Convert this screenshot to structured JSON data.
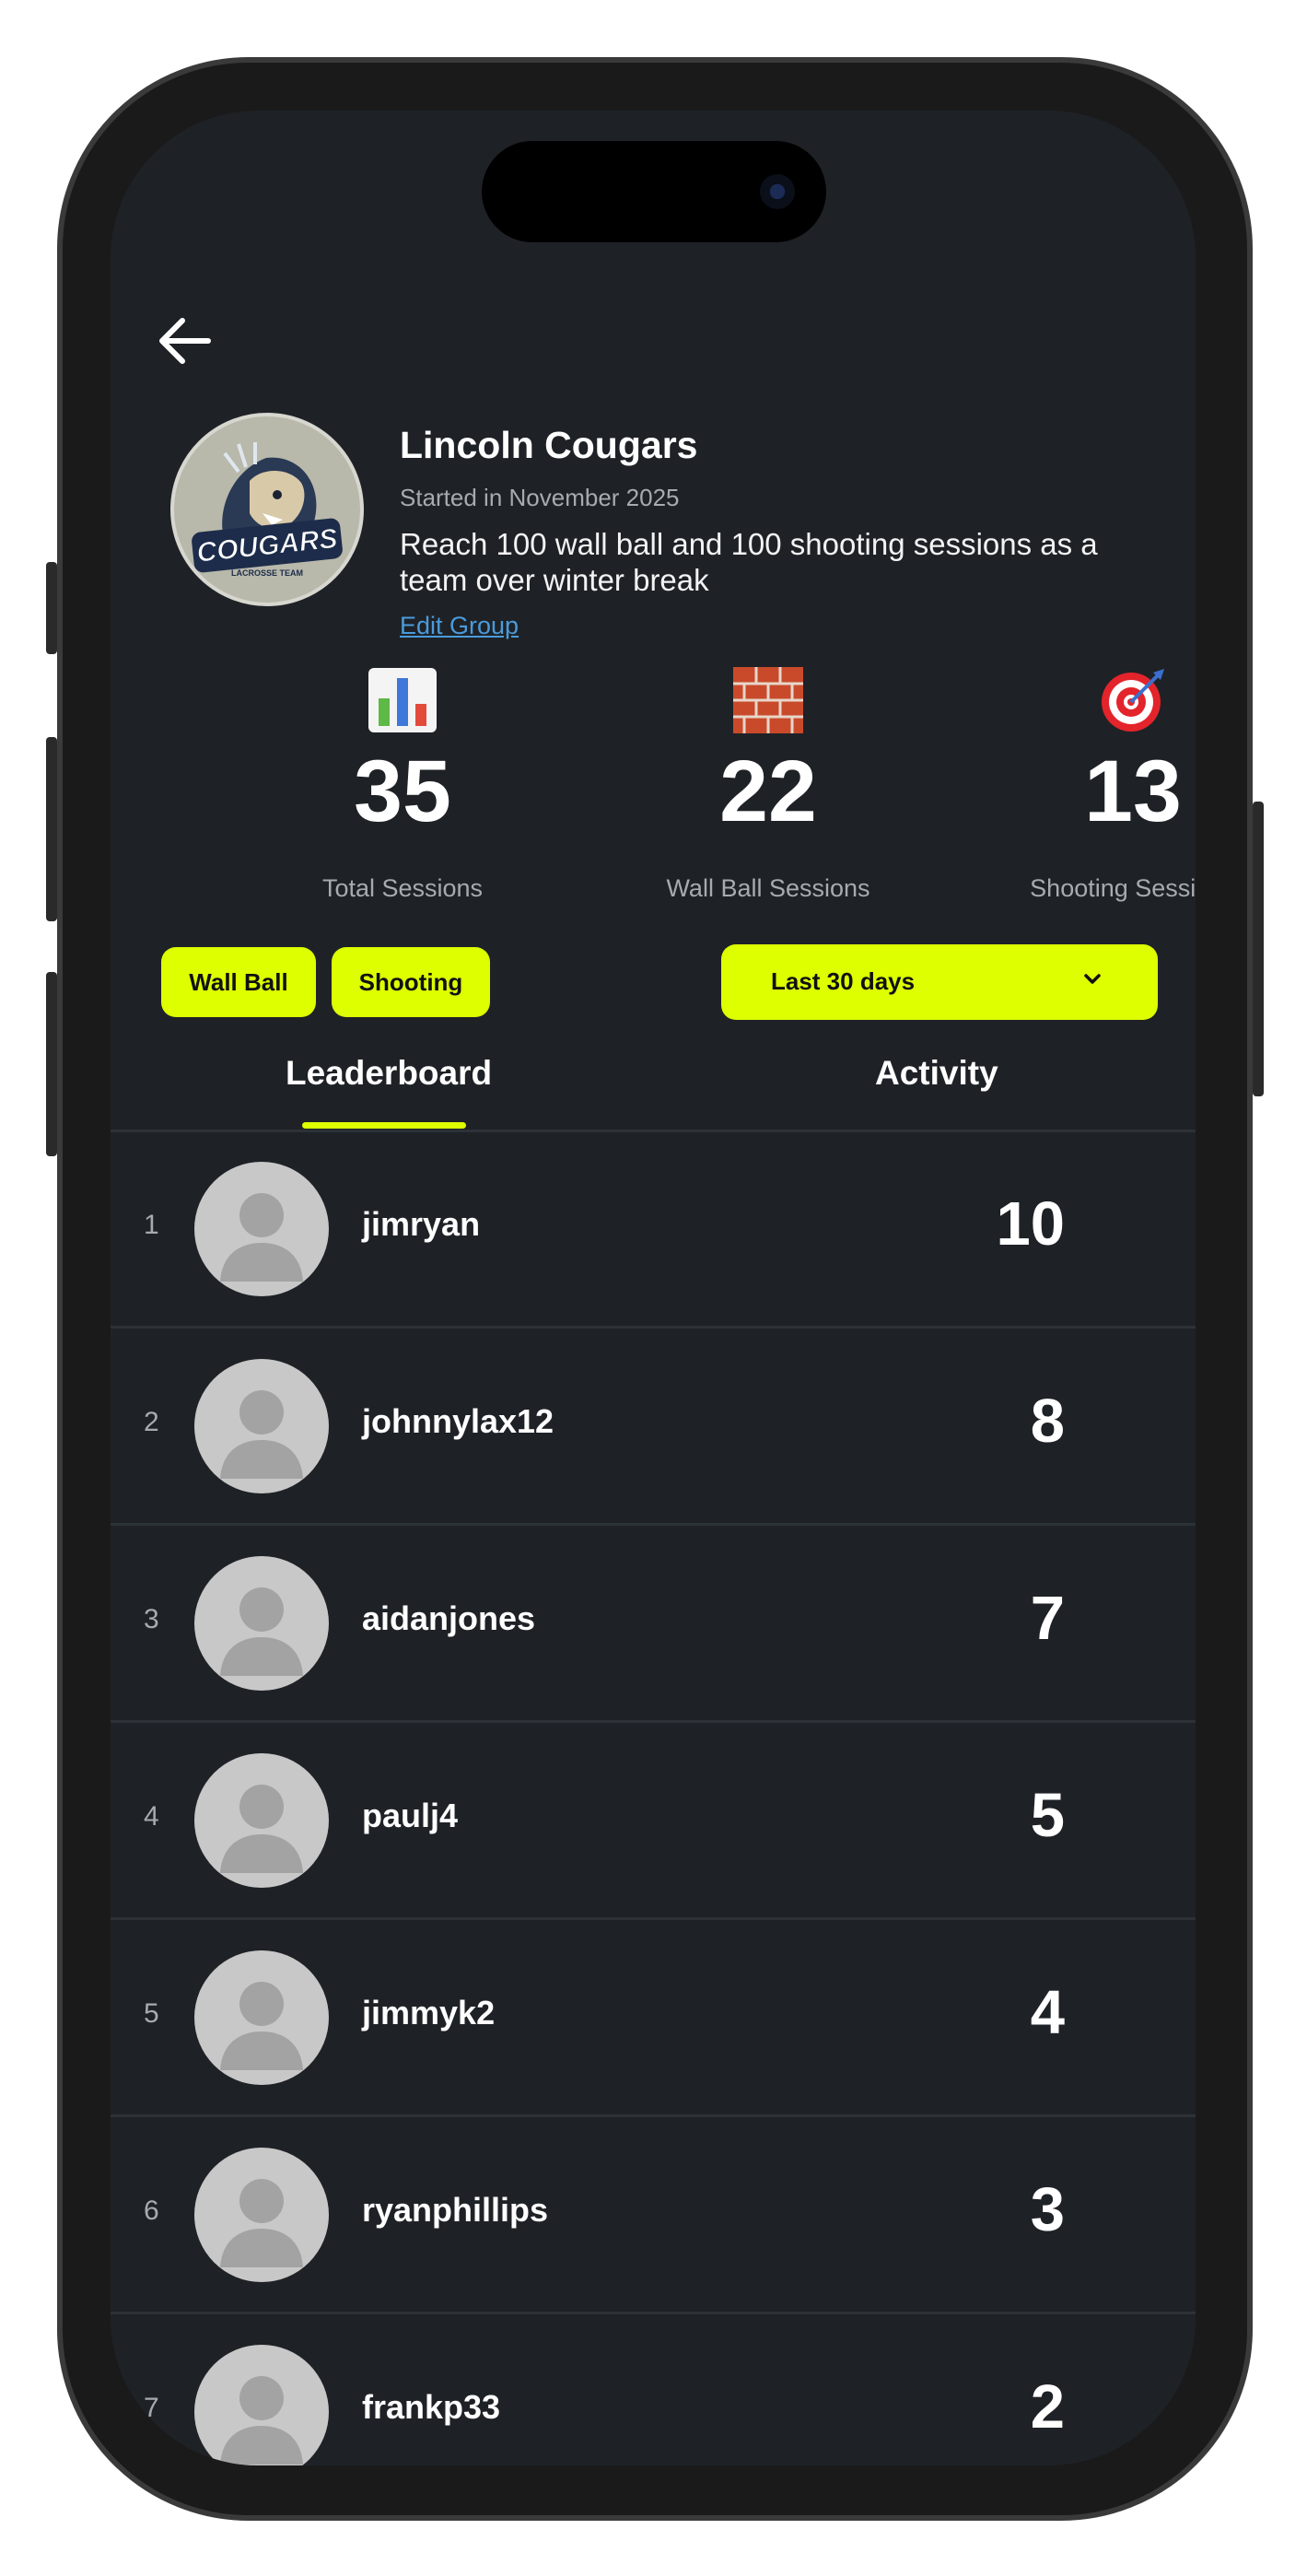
{
  "group": {
    "name": "Lincoln Cougars",
    "started": "Started in November 2025",
    "goal": "Reach 100 wall ball and 100 shooting sessions as a team over winter break",
    "edit_link": "Edit Group",
    "logo_text": "COUGARS",
    "logo_subtext": "LACROSSE TEAM"
  },
  "stats": [
    {
      "icon": "bar-chart-icon",
      "value": "35",
      "label": "Total Sessions"
    },
    {
      "icon": "brick-wall-icon",
      "value": "22",
      "label": "Wall Ball Sessions"
    },
    {
      "icon": "target-icon",
      "value": "13",
      "label": "Shooting Sessions"
    }
  ],
  "filters": {
    "chips": [
      "Wall Ball",
      "Shooting"
    ],
    "range": "Last 30 days"
  },
  "tabs": {
    "leaderboard": "Leaderboard",
    "activity": "Activity",
    "active": "leaderboard"
  },
  "leaderboard": [
    {
      "rank": "1",
      "username": "jimryan",
      "score": "10"
    },
    {
      "rank": "2",
      "username": "johnnylax12",
      "score": "8"
    },
    {
      "rank": "3",
      "username": "aidanjones",
      "score": "7"
    },
    {
      "rank": "4",
      "username": "paulj4",
      "score": "5"
    },
    {
      "rank": "5",
      "username": "jimmyk2",
      "score": "4"
    },
    {
      "rank": "6",
      "username": "ryanphillips",
      "score": "3"
    },
    {
      "rank": "7",
      "username": "frankp33",
      "score": "2"
    }
  ],
  "colors": {
    "accent": "#ddff00",
    "background": "#1e2226",
    "link": "#4a9bdc",
    "muted_text": "#a7abb0"
  }
}
